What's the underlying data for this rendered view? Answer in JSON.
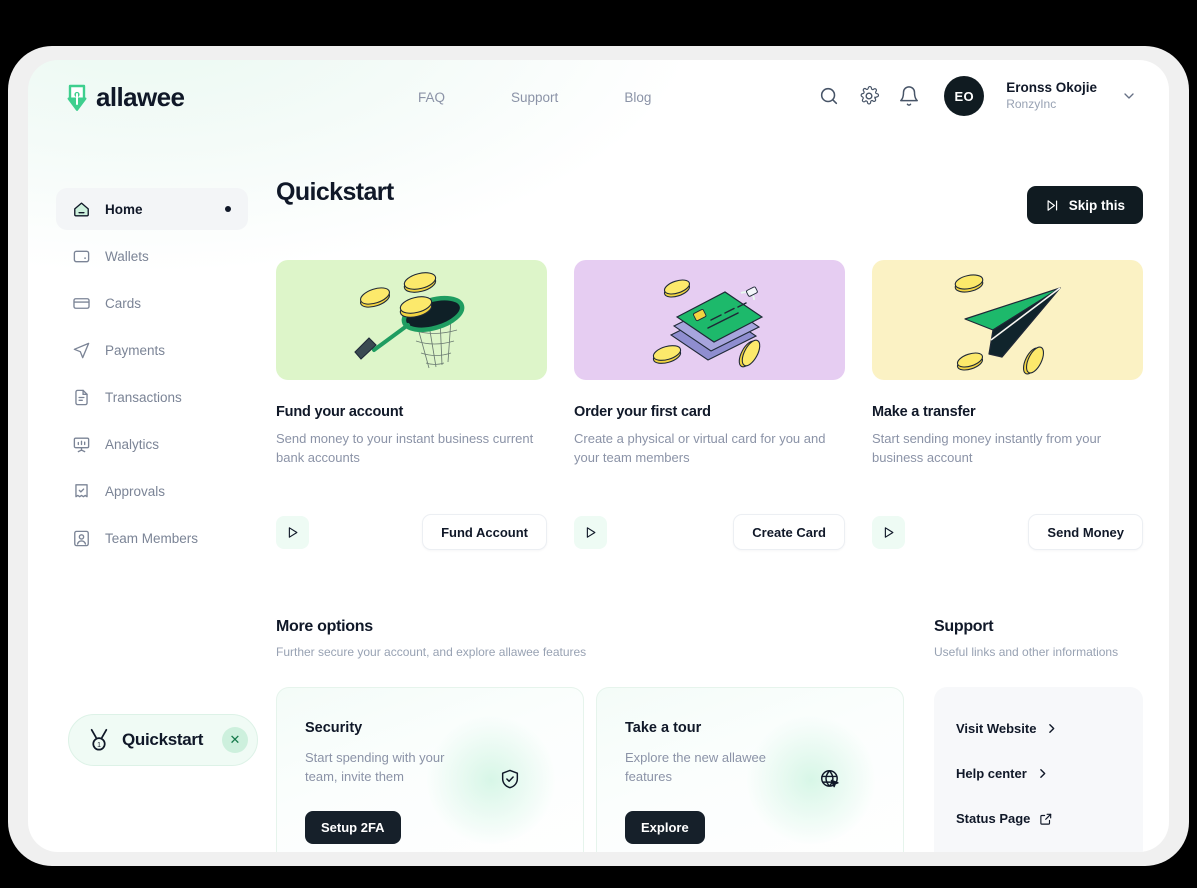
{
  "window": {
    "traffic_lights": [
      "dot-1",
      "dot-2",
      "dot-3"
    ]
  },
  "header": {
    "logo_text": "allawee",
    "logo_icon": "allawee-download-note-icon",
    "nav": [
      {
        "label": "FAQ"
      },
      {
        "label": "Support"
      },
      {
        "label": "Blog"
      }
    ],
    "icons": [
      {
        "name": "search-icon"
      },
      {
        "name": "gear-icon"
      },
      {
        "name": "bell-icon"
      }
    ],
    "user": {
      "initials": "EO",
      "name": "Eronss Okojie",
      "org": "RonzyInc",
      "caret_icon": "chevron-down-icon"
    }
  },
  "sidebar": {
    "items": [
      {
        "label": "Home",
        "icon": "home-icon",
        "active": true,
        "dot": true
      },
      {
        "label": "Wallets",
        "icon": "wallet-icon",
        "active": false
      },
      {
        "label": "Cards",
        "icon": "card-icon",
        "active": false
      },
      {
        "label": "Payments",
        "icon": "send-plane-icon",
        "active": false
      },
      {
        "label": "Transactions",
        "icon": "document-lines-icon",
        "active": false
      },
      {
        "label": "Analytics",
        "icon": "chart-board-icon",
        "active": false
      },
      {
        "label": "Approvals",
        "icon": "receipt-check-icon",
        "active": false
      },
      {
        "label": "Team Members",
        "icon": "user-square-icon",
        "active": false
      }
    ],
    "quickstart_pill": {
      "label": "Quickstart",
      "medal_icon": "medal-1-icon",
      "close_icon": "close-icon"
    }
  },
  "main": {
    "title": "Quickstart",
    "skip_button": {
      "label": "Skip this",
      "icon": "skip-forward-icon"
    },
    "quickstart_cards": [
      {
        "art": "coin-net-illustration",
        "art_bg": "#ddf5c9",
        "title": "Fund your account",
        "description": "Send money to your instant business current bank accounts",
        "play_icon": "play-icon",
        "cta": "Fund Account"
      },
      {
        "art": "stacked-cards-illustration",
        "art_bg": "#e6cdf2",
        "title": "Order your first card",
        "description": "Create a physical or virtual card for you and your team members",
        "play_icon": "play-icon",
        "cta": "Create Card"
      },
      {
        "art": "paper-plane-illustration",
        "art_bg": "#fbf2c4",
        "title": "Make a transfer",
        "description": "Start sending money instantly from your business account",
        "play_icon": "play-icon",
        "cta": "Send Money"
      }
    ],
    "more_options": {
      "title": "More options",
      "subtitle": "Further secure your account, and explore allawee features",
      "cards": [
        {
          "title": "Security",
          "description": "Start spending with your team, invite them",
          "icon": "shield-check-icon",
          "button": "Setup 2FA"
        },
        {
          "title": "Take a tour",
          "description": "Explore the new allawee features",
          "icon": "globe-cursor-icon",
          "button": "Explore"
        }
      ]
    },
    "support": {
      "title": "Support",
      "subtitle": "Useful links and other informations",
      "links": [
        {
          "label": "Visit Website",
          "icon": "chevron-right-icon"
        },
        {
          "label": "Help center",
          "icon": "chevron-right-icon"
        },
        {
          "label": "Status Page",
          "icon": "external-link-icon"
        }
      ]
    }
  },
  "colors": {
    "brand_green": "#3ecf8e",
    "dark": "#101b21",
    "card_green": "#ddf5c9",
    "card_purple": "#e6cdf2",
    "card_yellow": "#fbf2c4"
  }
}
